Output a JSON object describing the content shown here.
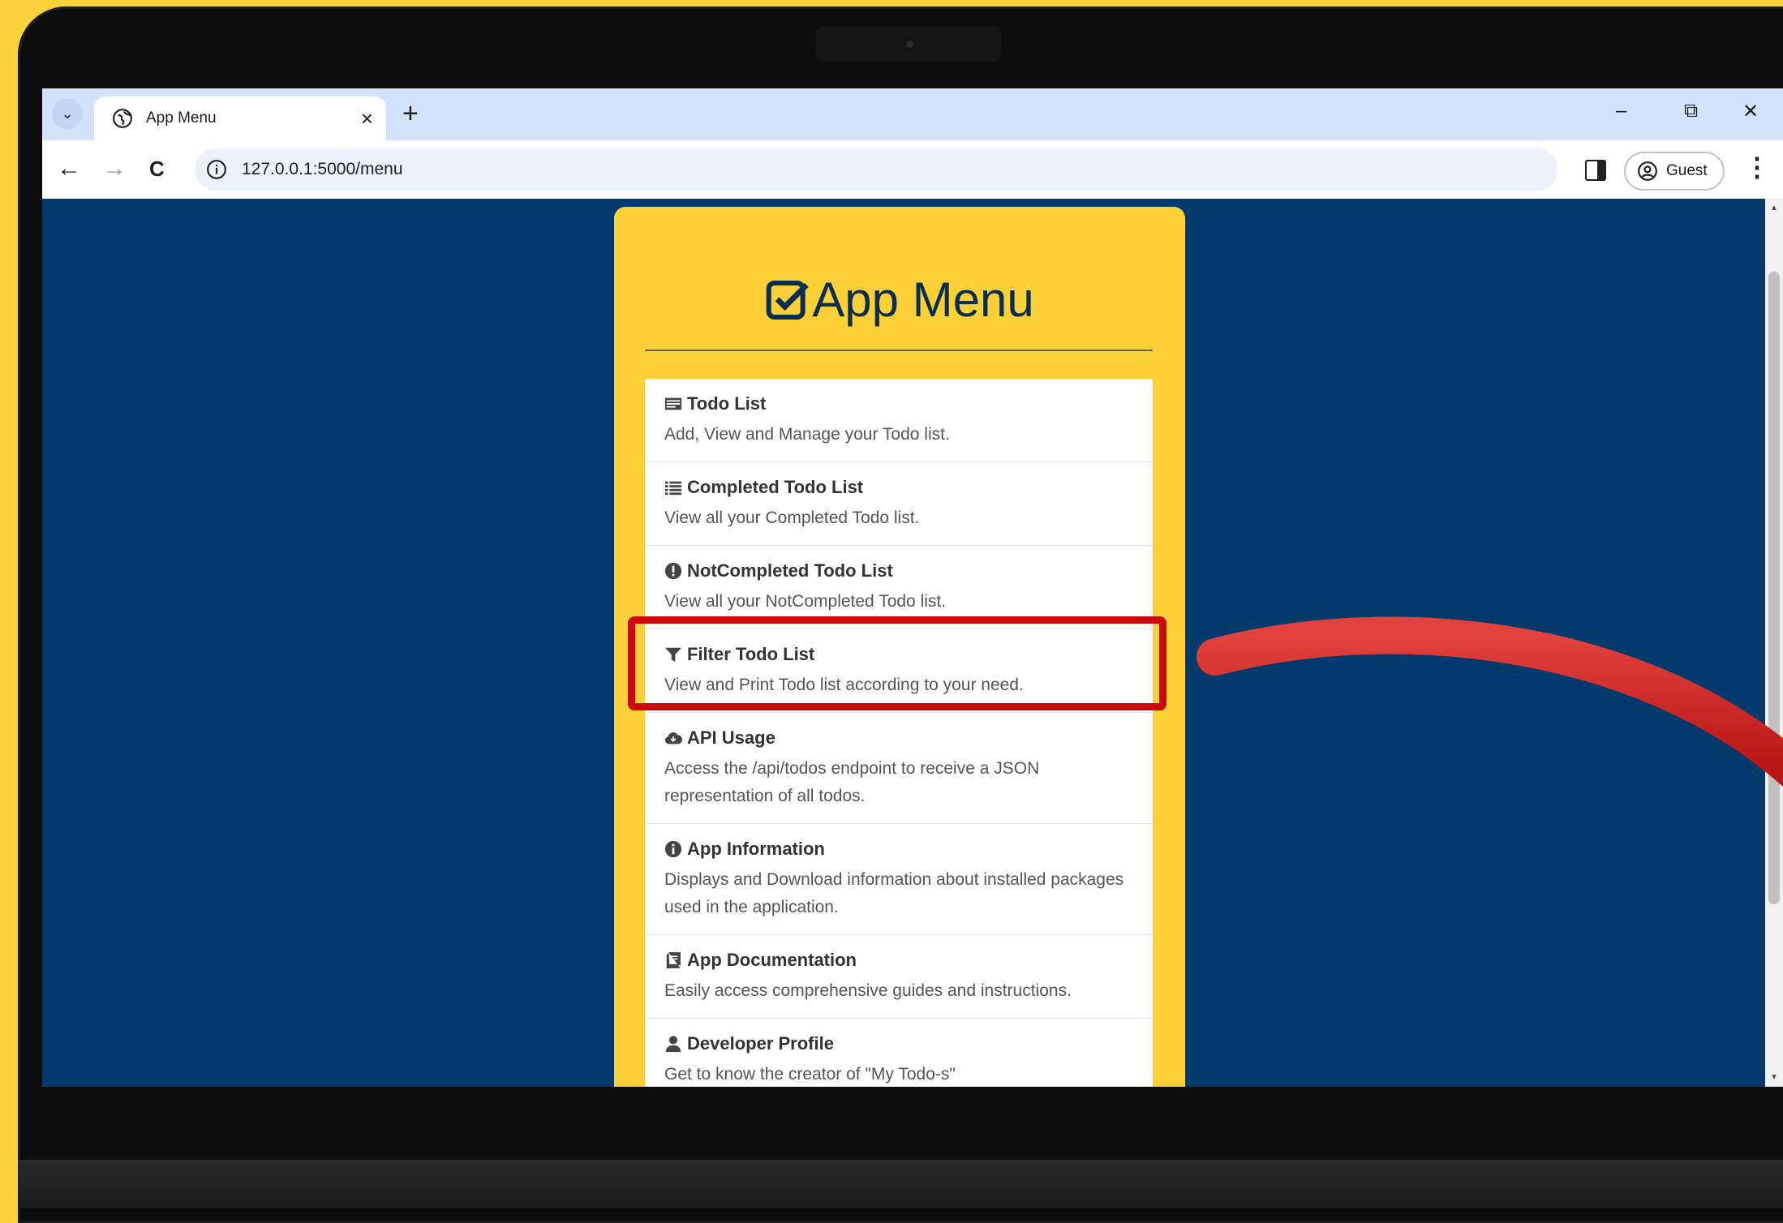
{
  "browser": {
    "tab_title": "App Menu",
    "new_tab_symbol": "+",
    "close_tab_symbol": "×",
    "url": "127.0.0.1:5000/menu",
    "profile_label": "Guest",
    "window_controls": {
      "minimize": "–",
      "restore": "⧉",
      "close": "✕"
    },
    "nav": {
      "back": "←",
      "forward": "→",
      "reload": "C"
    },
    "menu_symbol": "⋮"
  },
  "page": {
    "title": "App Menu",
    "accent_color": "#fbd137",
    "background_color": "#013a6b",
    "items": [
      {
        "icon": "list-alt-icon",
        "label": "Todo List",
        "description": "Add, View and Manage your Todo list."
      },
      {
        "icon": "list-icon",
        "label": "Completed Todo List",
        "description": "View all your Completed Todo list."
      },
      {
        "icon": "exclamation-circle-icon",
        "label": "NotCompleted Todo List",
        "description": "View all your NotCompleted Todo list."
      },
      {
        "icon": "filter-icon",
        "label": "Filter Todo List",
        "description": "View and Print Todo list according to your need."
      },
      {
        "icon": "cloud-icon",
        "label": "API Usage",
        "description": "Access the /api/todos endpoint to receive a JSON representation of all todos."
      },
      {
        "icon": "info-circle-icon",
        "label": "App Information",
        "description": "Displays and Download information about installed packages used in the application."
      },
      {
        "icon": "book-icon",
        "label": "App Documentation",
        "description": "Easily access comprehensive guides and instructions."
      },
      {
        "icon": "user-icon",
        "label": "Developer Profile",
        "description": "Get to know the creator of \"My Todo-s\""
      }
    ]
  },
  "annotation": {
    "highlight_color": "#cc0a0a",
    "highlighted_item": "Filter Todo List"
  }
}
